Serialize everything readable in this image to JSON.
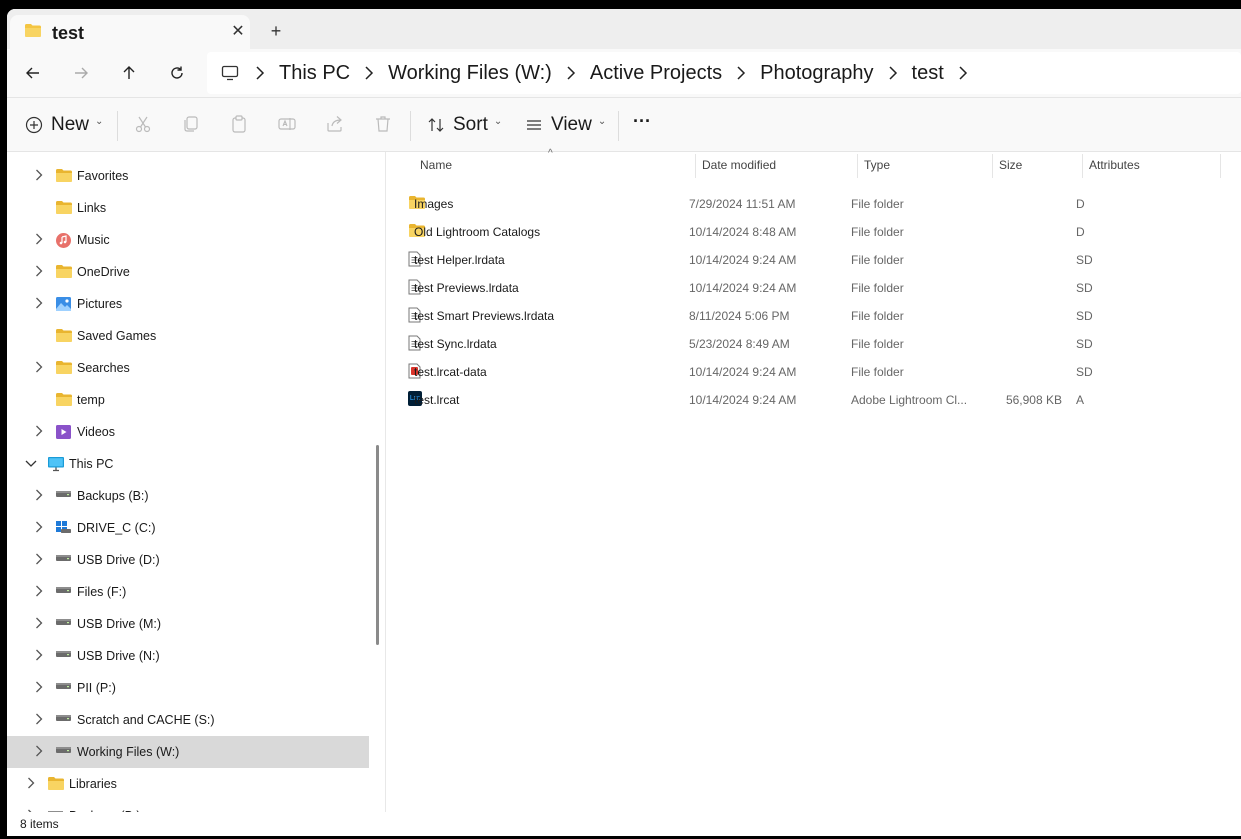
{
  "tab": {
    "title": "test",
    "close": "✕",
    "new_tab": "+"
  },
  "breadcrumb": [
    "This PC",
    "Working Files (W:)",
    "Active Projects",
    "Photography",
    "test"
  ],
  "toolbar": {
    "new_label": "New",
    "sort_label": "Sort",
    "view_label": "View",
    "more": "···"
  },
  "sidebar": {
    "items": [
      {
        "label": "Favorites",
        "icon": "folder-icon",
        "chevron": true,
        "indent": 1
      },
      {
        "label": "Links",
        "icon": "folder-icon",
        "chevron": false,
        "indent": 1
      },
      {
        "label": "Music",
        "icon": "music-icon",
        "chevron": true,
        "indent": 1
      },
      {
        "label": "OneDrive",
        "icon": "folder-icon",
        "chevron": true,
        "indent": 1
      },
      {
        "label": "Pictures",
        "icon": "pictures-icon",
        "chevron": true,
        "indent": 1
      },
      {
        "label": "Saved Games",
        "icon": "folder-icon",
        "chevron": false,
        "indent": 1
      },
      {
        "label": "Searches",
        "icon": "folder-icon",
        "chevron": true,
        "indent": 1
      },
      {
        "label": "temp",
        "icon": "folder-icon",
        "chevron": false,
        "indent": 1
      },
      {
        "label": "Videos",
        "icon": "videos-icon",
        "chevron": true,
        "indent": 1
      },
      {
        "label": "This PC",
        "icon": "this-pc-icon",
        "chevron": "down",
        "indent": 0
      },
      {
        "label": "Backups (B:)",
        "icon": "drive-icon",
        "chevron": true,
        "indent": 1
      },
      {
        "label": "DRIVE_C (C:)",
        "icon": "windows-drive-icon",
        "chevron": true,
        "indent": 1
      },
      {
        "label": "USB Drive (D:)",
        "icon": "drive-icon",
        "chevron": true,
        "indent": 1
      },
      {
        "label": "Files (F:)",
        "icon": "drive-icon",
        "chevron": true,
        "indent": 1
      },
      {
        "label": "USB Drive (M:)",
        "icon": "drive-icon",
        "chevron": true,
        "indent": 1
      },
      {
        "label": "USB Drive (N:)",
        "icon": "drive-icon",
        "chevron": true,
        "indent": 1
      },
      {
        "label": "PII (P:)",
        "icon": "drive-icon",
        "chevron": true,
        "indent": 1
      },
      {
        "label": "Scratch and CACHE (S:)",
        "icon": "drive-icon",
        "chevron": true,
        "indent": 1
      },
      {
        "label": "Working Files (W:)",
        "icon": "drive-icon",
        "chevron": true,
        "indent": 1,
        "selected": true
      },
      {
        "label": "Libraries",
        "icon": "folder-icon",
        "chevron": true,
        "indent": 0
      },
      {
        "label": "Backups (B:)",
        "icon": "drive-icon",
        "chevron": true,
        "indent": 0
      }
    ]
  },
  "columns": {
    "name": "Name",
    "date": "Date modified",
    "type": "Type",
    "size": "Size",
    "attributes": "Attributes"
  },
  "files": [
    {
      "name": "Images",
      "date": "7/29/2024 11:51 AM",
      "type": "File folder",
      "size": "",
      "attr": "D",
      "icon": "folder-icon"
    },
    {
      "name": "Old Lightroom Catalogs",
      "date": "10/14/2024 8:48 AM",
      "type": "File folder",
      "size": "",
      "attr": "D",
      "icon": "folder-icon"
    },
    {
      "name": "test Helper.lrdata",
      "date": "10/14/2024 9:24 AM",
      "type": "File folder",
      "size": "",
      "attr": "SD",
      "icon": "document-icon"
    },
    {
      "name": "test Previews.lrdata",
      "date": "10/14/2024 9:24 AM",
      "type": "File folder",
      "size": "",
      "attr": "SD",
      "icon": "document-icon"
    },
    {
      "name": "test Smart Previews.lrdata",
      "date": "8/11/2024 5:06 PM",
      "type": "File folder",
      "size": "",
      "attr": "SD",
      "icon": "document-icon"
    },
    {
      "name": "test Sync.lrdata",
      "date": "5/23/2024 8:49 AM",
      "type": "File folder",
      "size": "",
      "attr": "SD",
      "icon": "document-icon"
    },
    {
      "name": "test.lrcat-data",
      "date": "10/14/2024 9:24 AM",
      "type": "File folder",
      "size": "",
      "attr": "SD",
      "icon": "lrcat-data-icon"
    },
    {
      "name": "test.lrcat",
      "date": "10/14/2024 9:24 AM",
      "type": "Adobe Lightroom Cl...",
      "size": "56,908 KB",
      "attr": "A",
      "icon": "lightroom-icon",
      "icon_text": "Lrc"
    }
  ],
  "status": {
    "item_count": "8 items"
  },
  "colors": {
    "folder": "#f4c542",
    "selection": "#d9d9d9",
    "lightroom": "#001e36",
    "lightroom_text": "#31a8ff"
  }
}
